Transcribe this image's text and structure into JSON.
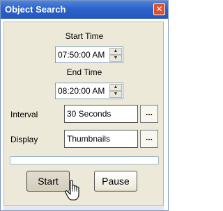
{
  "window": {
    "title": "Object Search",
    "close_symbol": "✕"
  },
  "start_time": {
    "label": "Start Time",
    "value": "07:50:00 AM"
  },
  "end_time": {
    "label": "End Time",
    "value": "08:20:00 AM"
  },
  "interval": {
    "label": "Interval",
    "value": "30 Seconds",
    "browse_label": "..."
  },
  "display": {
    "label": "Display",
    "value": "Thumbnails",
    "browse_label": "..."
  },
  "progress": {
    "value": 0
  },
  "buttons": {
    "start_label": "Start",
    "pause_label": "Pause"
  },
  "colors": {
    "title_bar": "#2d62c8",
    "close_button": "#d9532f",
    "panel": "#ece9d8"
  },
  "icons": {
    "close": "close-icon",
    "cursor": "hand-pointer-icon",
    "spin_up": "chevron-up-icon",
    "spin_down": "chevron-down-icon"
  }
}
